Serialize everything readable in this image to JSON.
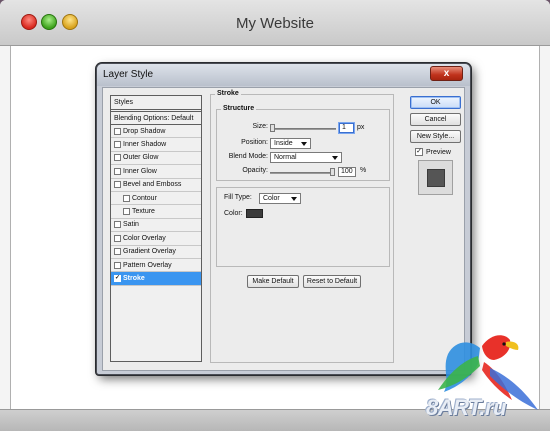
{
  "window": {
    "title": "My Website"
  },
  "dialog": {
    "title": "Layer Style",
    "close_label": "x",
    "styles_header": "Styles",
    "blending_options": "Blending Options: Default",
    "style_items": [
      {
        "label": "Drop Shadow",
        "checked": false,
        "indent": false,
        "active": false
      },
      {
        "label": "Inner Shadow",
        "checked": false,
        "indent": false,
        "active": false
      },
      {
        "label": "Outer Glow",
        "checked": false,
        "indent": false,
        "active": false
      },
      {
        "label": "Inner Glow",
        "checked": false,
        "indent": false,
        "active": false
      },
      {
        "label": "Bevel and Emboss",
        "checked": false,
        "indent": false,
        "active": false
      },
      {
        "label": "Contour",
        "checked": false,
        "indent": true,
        "active": false
      },
      {
        "label": "Texture",
        "checked": false,
        "indent": true,
        "active": false
      },
      {
        "label": "Satin",
        "checked": false,
        "indent": false,
        "active": false
      },
      {
        "label": "Color Overlay",
        "checked": false,
        "indent": false,
        "active": false
      },
      {
        "label": "Gradient Overlay",
        "checked": false,
        "indent": false,
        "active": false
      },
      {
        "label": "Pattern Overlay",
        "checked": false,
        "indent": false,
        "active": false
      },
      {
        "label": "Stroke",
        "checked": true,
        "indent": false,
        "active": true
      }
    ],
    "stroke": {
      "section_title": "Stroke",
      "structure_title": "Structure",
      "size_label": "Size:",
      "size_value": "1",
      "size_unit": "px",
      "position_label": "Position:",
      "position_value": "Inside",
      "blend_mode_label": "Blend Mode:",
      "blend_mode_value": "Normal",
      "opacity_label": "Opacity:",
      "opacity_value": "100",
      "opacity_unit": "%",
      "fill_type_label": "Fill Type:",
      "fill_type_value": "Color",
      "color_label": "Color:",
      "color_value": "#3c3c3c"
    },
    "buttons": {
      "make_default": "Make Default",
      "reset_default": "Reset to Default",
      "ok": "OK",
      "cancel": "Cancel",
      "new_style": "New Style..."
    },
    "preview_label": "Preview",
    "preview_checked": true
  },
  "watermark": {
    "text": "8ART.ru"
  }
}
